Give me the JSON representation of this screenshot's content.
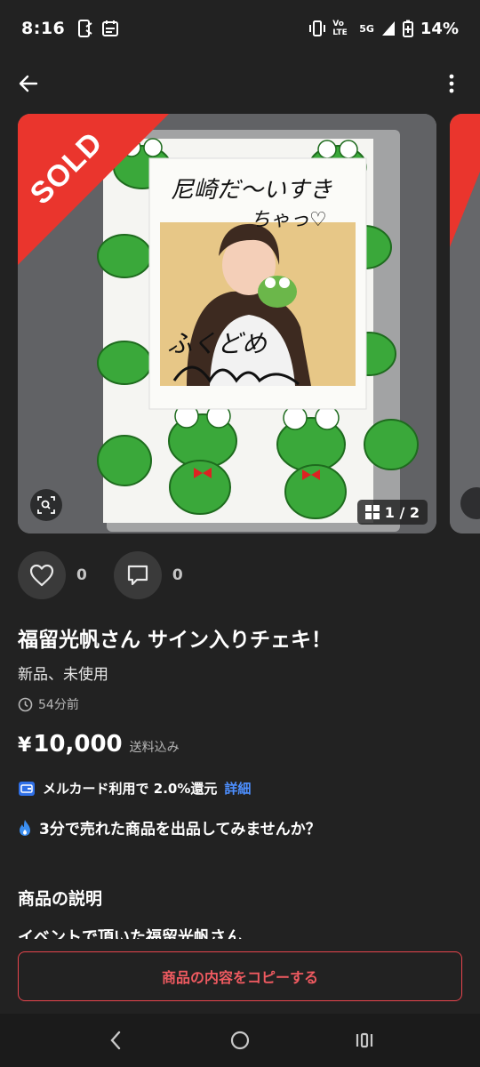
{
  "status_bar": {
    "time": "8:16",
    "network_label": "5G",
    "volte_label": "Vo LTE",
    "battery": "14%"
  },
  "header": {
    "back_icon": "arrow-left-icon",
    "more_icon": "more-vertical-icon"
  },
  "gallery": {
    "sold_badge": "SOLD",
    "page_indicator": "1 / 2",
    "current_page": 1,
    "total_pages": 2,
    "photo_handwriting_line1": "尼崎だ〜いすき",
    "photo_handwriting_line2": "ちゃっ♡",
    "photo_signature_name": "ふくどめ"
  },
  "actions": {
    "like_count": "0",
    "comment_count": "0"
  },
  "item": {
    "title": "福留光帆さん サイン入りチェキ！",
    "condition": "新品、未使用",
    "posted": "54分前",
    "price_symbol": "¥",
    "price": "10,000",
    "shipping": "送料込み"
  },
  "mercard": {
    "text": "メルカード利用で 2.0%還元",
    "link": "詳細"
  },
  "promo": {
    "text": "3分で売れた商品を出品してみませんか？"
  },
  "description": {
    "heading": "商品の説明",
    "preview": "イベントで頂いた福留光帆さん"
  },
  "bottom": {
    "copy_button": "商品の内容をコピーする"
  },
  "colors": {
    "background": "#222222",
    "sold_red": "#ea352d",
    "link_blue": "#4d8fff",
    "copy_button_red": "#ee5a60"
  }
}
